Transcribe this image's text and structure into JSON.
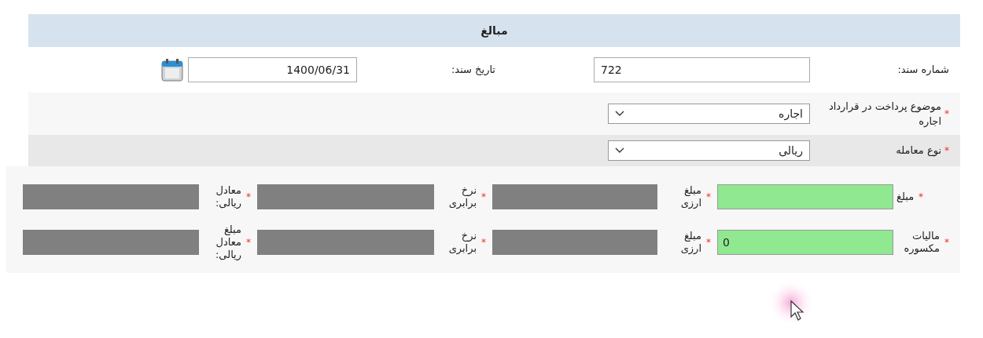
{
  "title": "مبالغ",
  "required_mark": "*",
  "doc_fields": [
    {
      "label": "شماره سند:",
      "kind": "text",
      "value": "722"
    },
    {
      "label": "تاریخ سند:",
      "kind": "date",
      "value": "1400/06/31"
    }
  ],
  "rows": [
    {
      "label": "موضوع پرداخت در قرارداد اجاره",
      "required": true,
      "kind": "select",
      "value": "اجاره"
    },
    {
      "label": "نوع معامله",
      "required": true,
      "kind": "select",
      "value": "ریالی"
    }
  ],
  "amount_rows": [
    {
      "cells": [
        {
          "label": "مبلغ",
          "required": true,
          "disabled": false
        },
        {
          "label": "مبلغ ارزی",
          "required": true,
          "disabled": true
        },
        {
          "label": "نرخ برابری",
          "required": true,
          "disabled": true
        },
        {
          "label": "معادل ریالی:",
          "required": true,
          "disabled": true
        }
      ]
    },
    {
      "cells": [
        {
          "label": "مالیات مکسوره",
          "required": true,
          "disabled": false,
          "value": "0"
        },
        {
          "label": "مبلغ ارزی",
          "required": true,
          "disabled": true
        },
        {
          "label": "نرخ برابری",
          "required": true,
          "disabled": true
        },
        {
          "label": "مبلغ معادل ریالی:",
          "required": true,
          "disabled": true
        }
      ]
    }
  ]
}
